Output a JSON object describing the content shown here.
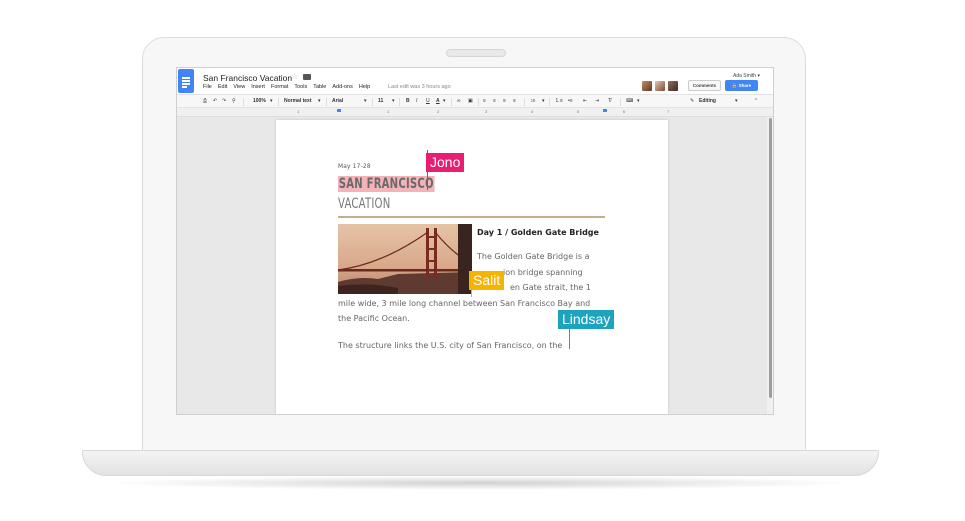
{
  "doc": {
    "title": "San Francisco Vacation",
    "last_edit": "Last edit was 3 hours ago"
  },
  "menu": [
    "File",
    "Edit",
    "View",
    "Insert",
    "Format",
    "Tools",
    "Table",
    "Add-ons",
    "Help"
  ],
  "account": {
    "user": "Ada Smith ▾",
    "comments_label": "Comments",
    "share_label": "Share"
  },
  "toolbar": {
    "zoom": "100%",
    "style": "Normal text",
    "font": "Arial",
    "size": "11",
    "mode": "Editing"
  },
  "ruler": [
    "1",
    "1",
    "2",
    "3",
    "4",
    "5",
    "6",
    "7"
  ],
  "content": {
    "date": "May 17-28",
    "title_line1": "SAN FRANCISCO",
    "title_line2": "VACATION",
    "day_heading": "Day 1 / Golden Gate Bridge",
    "para1_line1": "The Golden Gate Bridge is a",
    "para1_line2": "ion bridge spanning",
    "para1_line3": "en Gate strait, the 1",
    "para1_line4": "mile wide, 3 mile long channel between San Francisco Bay and",
    "para1_line5": "the Pacific Ocean.",
    "para2_line1": "The structure links the U.S. city of San Francisco, on the"
  },
  "collaborators": [
    {
      "name": "Jono",
      "color": "#e91e73"
    },
    {
      "name": "Salit",
      "color": "#f4b400"
    },
    {
      "name": "Lindsay",
      "color": "#1ea3bf"
    }
  ],
  "colors": {
    "brand": "#4285f4",
    "highlight": "#f3b3b8",
    "rule": "#c7ad8a"
  }
}
